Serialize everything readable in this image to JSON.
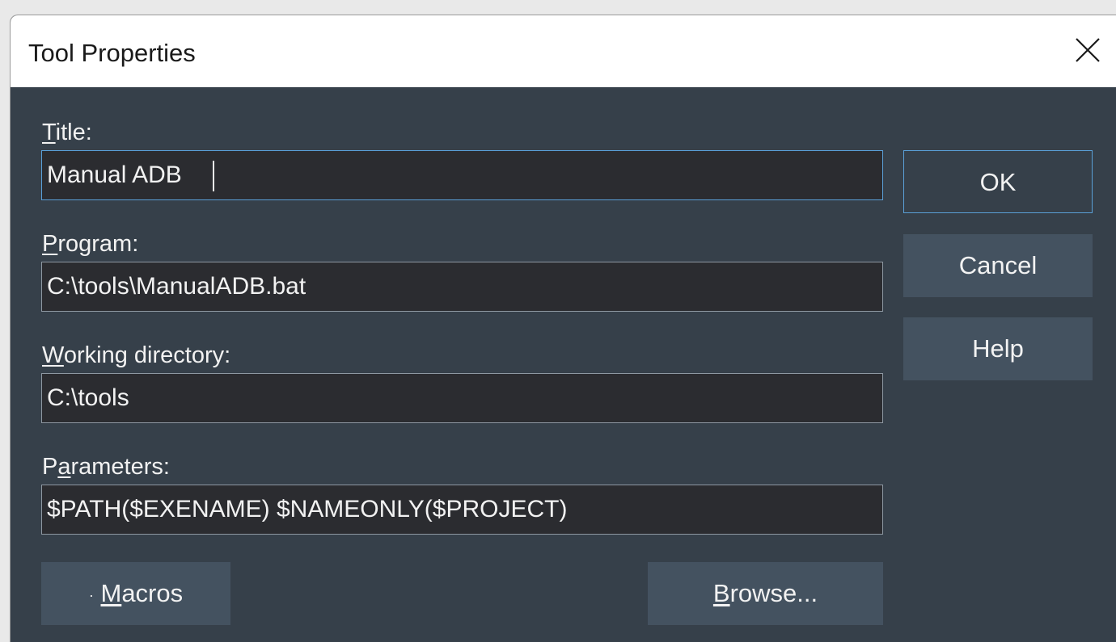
{
  "window": {
    "title": "Tool Properties"
  },
  "fields": {
    "title": {
      "label_accel": "T",
      "label_rest": "itle:",
      "value": "Manual ADB"
    },
    "program": {
      "label_accel": "P",
      "label_rest": "rogram:",
      "value": "C:\\tools\\ManualADB.bat"
    },
    "working_directory": {
      "label_accel": "W",
      "label_rest": "orking directory:",
      "value": "C:\\tools"
    },
    "parameters": {
      "label_pre": "P",
      "label_accel": "a",
      "label_rest": "rameters:",
      "value": "$PATH($EXENAME) $NAMEONLY($PROJECT)"
    }
  },
  "buttons": {
    "ok": "OK",
    "cancel": "Cancel",
    "help": "Help",
    "macros_prefix": "·",
    "macros_accel": "M",
    "macros_rest": "acros",
    "browse_accel": "B",
    "browse_rest": "rowse..."
  },
  "colors": {
    "dialog_bg": "#36404a",
    "field_bg": "#2b2c30",
    "button_bg": "#445260",
    "focus_border": "#5aa0d8",
    "titlebar_bg": "#ffffff"
  },
  "icons": {
    "close": "close-icon"
  }
}
